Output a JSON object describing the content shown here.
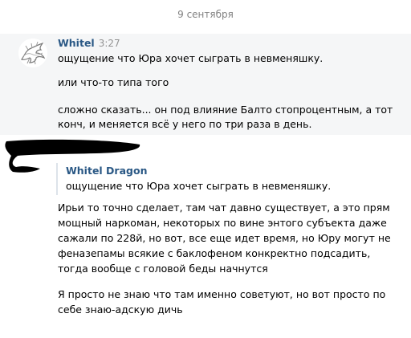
{
  "date_separator": "9 сентября",
  "message_group": {
    "author": "Whitel",
    "time": "3:27",
    "messages": [
      "ощущение что Юра хочет сыграть в невменяшку.",
      "или что-то типа того",
      "сложно сказать... он под влияние Балто стопроцентным, а тот",
      "конч, и меняется всё у него по три раза в день."
    ]
  },
  "reply_block": {
    "quote": {
      "author": "Whitel Dragon",
      "text": "ощущение что Юра хочет сыграть в невменяшку."
    },
    "lines": [
      "Ирьи то точно сделает, там чат давно существует, а это прям",
      "мощный наркоман, некоторых по вине энтого субъекта даже",
      "сажали по 228й, но вот, все еще идет время, но Юру могут не",
      "феназепамы всякие с баклофеном конкректно подсадить,",
      "тогда вообще с головой беды начнутся",
      "Я просто не знаю что там именно советуют, но вот просто по",
      "себе знаю-адскую дичь"
    ]
  },
  "colors": {
    "author_link": "#2a5885",
    "meta_gray": "#828282",
    "highlight_bg": "#f5f6f7",
    "quote_border": "#dde3ea"
  }
}
